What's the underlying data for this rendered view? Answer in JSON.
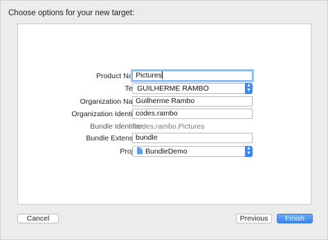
{
  "dialog": {
    "header": "Choose options for your new target:"
  },
  "form": {
    "product_name": {
      "label": "Product Name:",
      "value": "Pictures"
    },
    "team": {
      "label": "Team:",
      "value": "GUILHERME RAMBO"
    },
    "organization_name": {
      "label": "Organization Name:",
      "value": "Guilherme Rambo"
    },
    "organization_identifier": {
      "label": "Organization Identifier:",
      "value": "codes.rambo"
    },
    "bundle_identifier": {
      "label": "Bundle Identifier:",
      "value": "codes.rambo.Pictures"
    },
    "bundle_extension": {
      "label": "Bundle Extension:",
      "value": "bundle"
    },
    "project": {
      "label": "Project:",
      "value": "BundleDemo",
      "icon": "project-file-icon"
    }
  },
  "footer": {
    "cancel_label": "Cancel",
    "previous_label": "Previous",
    "finish_label": "Finish"
  },
  "colors": {
    "accent": "#3c84ef",
    "focus_ring": "#a9c8f0"
  }
}
